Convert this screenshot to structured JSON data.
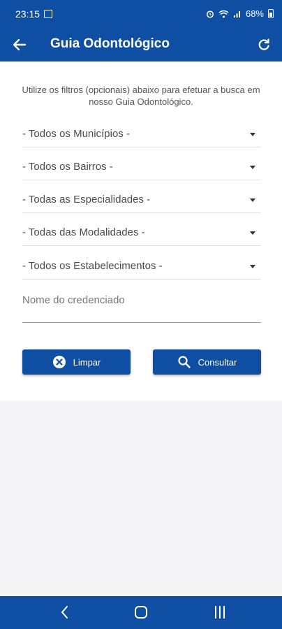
{
  "status_bar": {
    "time": "23:15",
    "battery": "68%"
  },
  "appbar": {
    "title": "Guia Odontológico",
    "back_icon": "arrow-left-icon",
    "refresh_icon": "refresh-icon"
  },
  "intro_text": "Utilize os filtros (opcionais) abaixo para efetuar a busca em nosso Guia Odontológico.",
  "filters": {
    "municipios": "- Todos os Municípios -",
    "bairros": "- Todos os Bairros -",
    "especialidades": "- Todas as Especialidades -",
    "modalidades": "- Todas das Modalidades -",
    "estabelecimentos": "- Todos os Estabelecimentos -"
  },
  "name_field": {
    "placeholder": "Nome do credenciado",
    "value": ""
  },
  "buttons": {
    "clear_label": "Limpar",
    "search_label": "Consultar"
  },
  "colors": {
    "primary": "#0f4fa3",
    "background": "#f5f5f7"
  }
}
